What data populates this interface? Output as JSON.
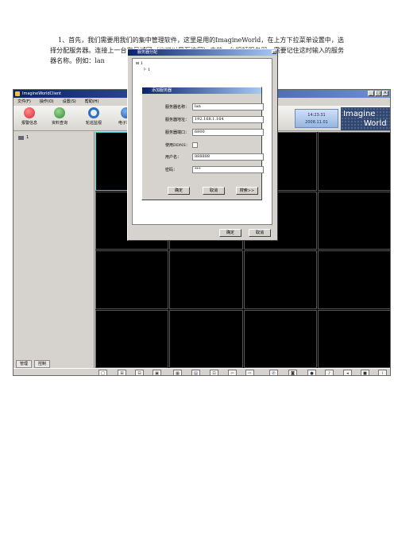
{
  "instruction": "1、首先，我们需要用我们的集中管理软件，这里是用的ImagineWorld，在上方下拉菜单设置中，选择分配服务器。连接上一台在局域网（也可以是互连网）中的一台视频服务器。需要记住这时输入的服务器名称。例如：lan",
  "window": {
    "title": "ImagineWorldClient",
    "menu": [
      "文件(F)",
      "操作(O)",
      "设置(S)",
      "帮助(H)"
    ],
    "tools": [
      {
        "label": "报警信息",
        "icon": "alarm-icon",
        "color": "#d8283a"
      },
      {
        "label": "资料查询",
        "icon": "user-search-icon",
        "color": "#2e8b3a"
      },
      {
        "label": "轮巡监视",
        "icon": "cycle-icon",
        "color": "#2f6fc0"
      },
      {
        "label": "电子地图",
        "icon": "globe-icon",
        "color": "#1b4fa0"
      }
    ],
    "clock": {
      "time": "14:23:31",
      "date": "2008.11.01"
    },
    "logo": [
      "Imagine",
      "World"
    ],
    "tree_root": "1",
    "tabs": [
      "管理",
      "控制"
    ]
  },
  "dialog_assign": {
    "title": "服务器分配",
    "tree": [
      "1",
      "1"
    ],
    "ok": "确定",
    "cancel": "取消"
  },
  "dialog_add": {
    "title": "添加服务器",
    "fields": [
      {
        "label": "服务器名称：",
        "value": "lan"
      },
      {
        "label": "服务器地址：",
        "value": "192.168.1.164"
      },
      {
        "label": "服务器端口：",
        "value": "6800"
      },
      {
        "label": "使用DDNS：",
        "value": ""
      },
      {
        "label": "用户名：",
        "value": "888888"
      },
      {
        "label": "密码：",
        "value": "***"
      }
    ],
    "ok": "确定",
    "cancel": "取消",
    "search": "搜索>>"
  }
}
